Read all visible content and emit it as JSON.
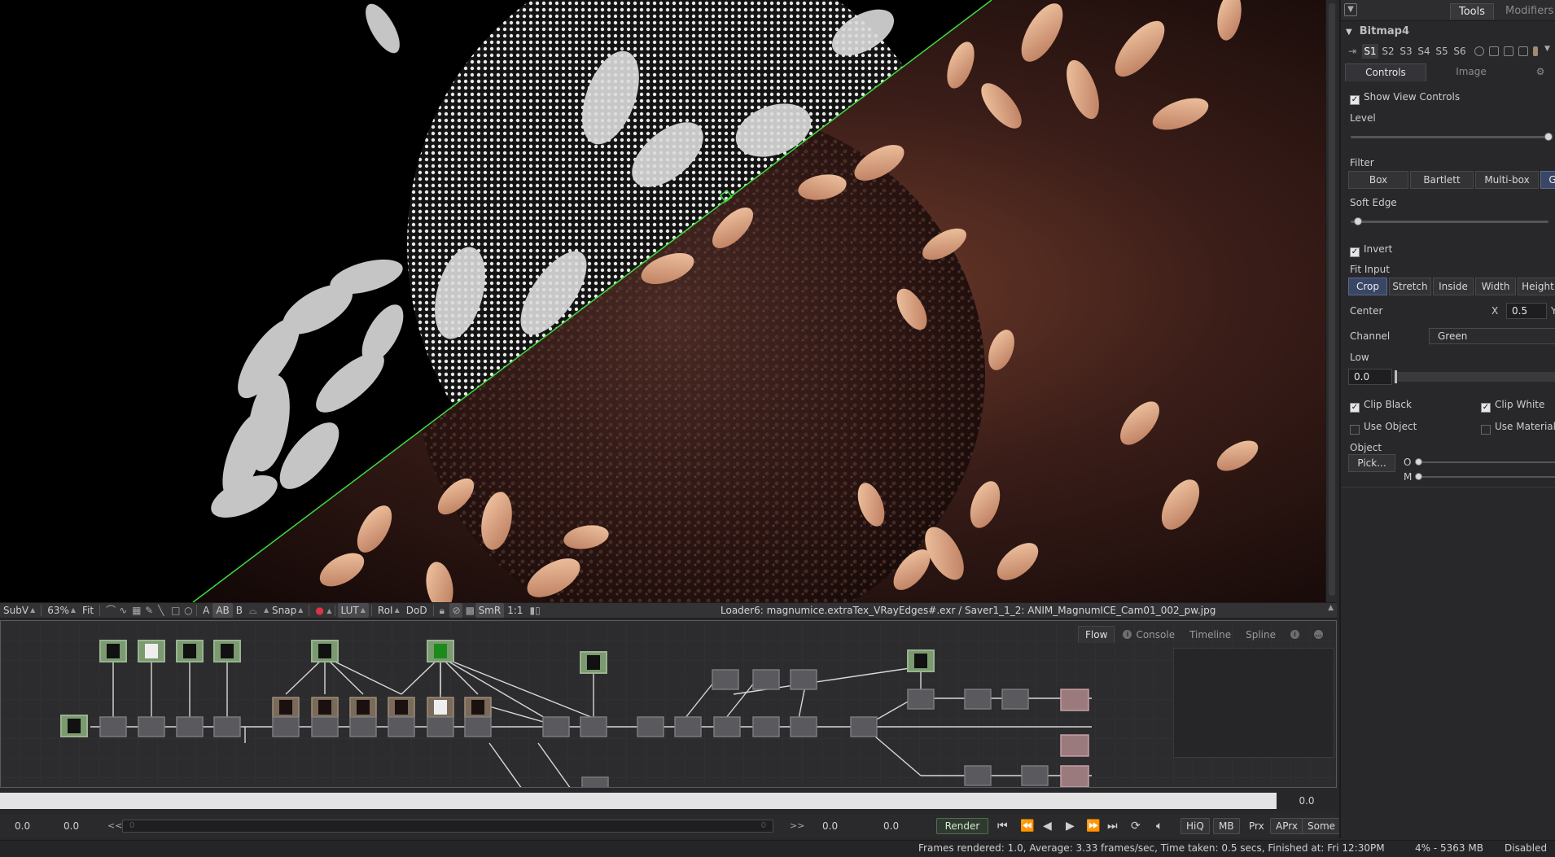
{
  "viewer": {
    "toolbar": {
      "subv": "SubV",
      "zoom": "63%",
      "fit": "Fit",
      "a": "A",
      "ab": "AB",
      "b": "B",
      "snap": "Snap",
      "lut": "LUT",
      "roi": "RoI",
      "dod": "DoD",
      "smr": "SmR",
      "ratio": "1:1"
    },
    "status": "Loader6: magnumice.extraTex_VRayEdges#.exr / Saver1_1_2: ANIM_MagnumICE_Cam01_002_pw.jpg"
  },
  "flow": {
    "tabs": [
      {
        "label": "Flow"
      },
      {
        "label": "Console"
      },
      {
        "label": "Timeline"
      },
      {
        "label": "Spline"
      }
    ]
  },
  "time": {
    "current": "0.0",
    "start": "0.0",
    "render_start": "0.0",
    "back_label": "<<",
    "fwd_label": ">>",
    "render_end": "0.0",
    "end": "0.0",
    "slider_left": "0",
    "slider_right": "0"
  },
  "transport": {
    "render": "Render",
    "hiq": "HiQ",
    "mb": "MB",
    "prx": "Prx",
    "aprx": "APrx",
    "some": "Some"
  },
  "status_bar": {
    "frames": "Frames rendered: 1.0,  Average: 3.33 frames/sec,  Time taken: 0.5 secs,  Finished at: Fri 12:30PM",
    "memory": "4% - 5363 MB",
    "state": "Disabled"
  },
  "tools": {
    "tabs": [
      "Tools",
      "Modifiers"
    ],
    "tool_name": "Bitmap4",
    "stabs": [
      "S1",
      "S2",
      "S3",
      "S4",
      "S5",
      "S6"
    ],
    "control_tabs": [
      "Controls",
      "Image"
    ],
    "show_view_controls": "Show View Controls",
    "level": "Level",
    "level_value": 1.0,
    "filter": "Filter",
    "filter_options": [
      "Box",
      "Bartlett",
      "Multi-box",
      "G"
    ],
    "soft_edge": "Soft Edge",
    "soft_edge_value": 0.0,
    "invert": "Invert",
    "fit_input": "Fit Input",
    "fit_options": [
      "Crop",
      "Stretch",
      "Inside",
      "Width",
      "Height"
    ],
    "center": "Center",
    "center_x_label": "X",
    "center_x": "0.5",
    "center_y_label": "Y",
    "channel": "Channel",
    "channel_value": "Green",
    "low": "Low",
    "low_value": "0.0",
    "clip_black": "Clip Black",
    "clip_white": "Clip White",
    "use_object": "Use Object",
    "use_material": "Use Material",
    "object": "Object",
    "pick": "Pick...",
    "o_label": "O",
    "m_label": "M"
  },
  "colors": {
    "accent": "#3a4764",
    "panel": "#28282a",
    "render_green": "#516e51",
    "split_line": "#3ddc3d"
  }
}
